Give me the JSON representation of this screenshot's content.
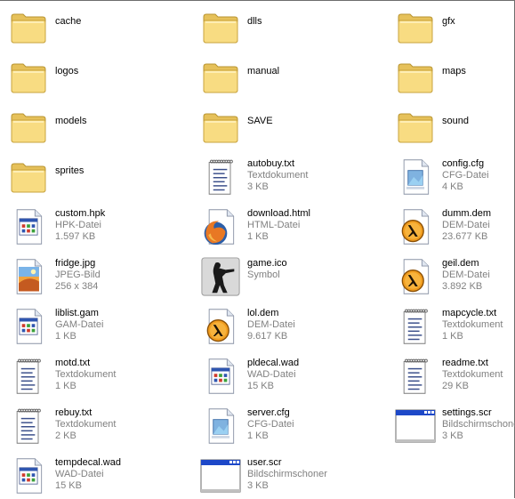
{
  "items": [
    {
      "name": "cache",
      "type": "",
      "size": "",
      "icon": "folder-icon"
    },
    {
      "name": "dlls",
      "type": "",
      "size": "",
      "icon": "folder-icon"
    },
    {
      "name": "gfx",
      "type": "",
      "size": "",
      "icon": "folder-icon"
    },
    {
      "name": "logos",
      "type": "",
      "size": "",
      "icon": "folder-icon"
    },
    {
      "name": "manual",
      "type": "",
      "size": "",
      "icon": "folder-icon"
    },
    {
      "name": "maps",
      "type": "",
      "size": "",
      "icon": "folder-icon"
    },
    {
      "name": "models",
      "type": "",
      "size": "",
      "icon": "folder-icon"
    },
    {
      "name": "SAVE",
      "type": "",
      "size": "",
      "icon": "folder-icon"
    },
    {
      "name": "sound",
      "type": "",
      "size": "",
      "icon": "folder-icon"
    },
    {
      "name": "sprites",
      "type": "",
      "size": "",
      "icon": "folder-icon"
    },
    {
      "name": "autobuy.txt",
      "type": "Textdokument",
      "size": "3 KB",
      "icon": "text-document-icon"
    },
    {
      "name": "config.cfg",
      "type": "CFG-Datei",
      "size": "4 KB",
      "icon": "cfg-file-icon"
    },
    {
      "name": "custom.hpk",
      "type": "HPK-Datei",
      "size": "1.597 KB",
      "icon": "generic-file-icon"
    },
    {
      "name": "download.html",
      "type": "HTML-Datei",
      "size": "1 KB",
      "icon": "firefox-html-icon"
    },
    {
      "name": "dumm.dem",
      "type": "DEM-Datei",
      "size": "23.677 KB",
      "icon": "half-life-icon"
    },
    {
      "name": "fridge.jpg",
      "type": "JPEG-Bild",
      "size": "256 x 384",
      "icon": "jpeg-image-icon"
    },
    {
      "name": "game.ico",
      "type": "Symbol",
      "size": "",
      "icon": "counter-strike-icon"
    },
    {
      "name": "geil.dem",
      "type": "DEM-Datei",
      "size": "3.892 KB",
      "icon": "half-life-icon"
    },
    {
      "name": "liblist.gam",
      "type": "GAM-Datei",
      "size": "1 KB",
      "icon": "generic-file-icon"
    },
    {
      "name": "lol.dem",
      "type": "DEM-Datei",
      "size": "9.617 KB",
      "icon": "half-life-icon"
    },
    {
      "name": "mapcycle.txt",
      "type": "Textdokument",
      "size": "1 KB",
      "icon": "text-document-icon"
    },
    {
      "name": "motd.txt",
      "type": "Textdokument",
      "size": "1 KB",
      "icon": "text-document-icon"
    },
    {
      "name": "pldecal.wad",
      "type": "WAD-Datei",
      "size": "15 KB",
      "icon": "generic-file-icon"
    },
    {
      "name": "readme.txt",
      "type": "Textdokument",
      "size": "29 KB",
      "icon": "text-document-icon"
    },
    {
      "name": "rebuy.txt",
      "type": "Textdokument",
      "size": "2 KB",
      "icon": "text-document-icon"
    },
    {
      "name": "server.cfg",
      "type": "CFG-Datei",
      "size": "1 KB",
      "icon": "cfg-file-icon"
    },
    {
      "name": "settings.scr",
      "type": "Bildschirmschoner",
      "size": "3 KB",
      "icon": "screensaver-icon"
    },
    {
      "name": "tempdecal.wad",
      "type": "WAD-Datei",
      "size": "15 KB",
      "icon": "generic-file-icon"
    },
    {
      "name": "user.scr",
      "type": "Bildschirmschoner",
      "size": "3 KB",
      "icon": "screensaver-icon"
    }
  ]
}
